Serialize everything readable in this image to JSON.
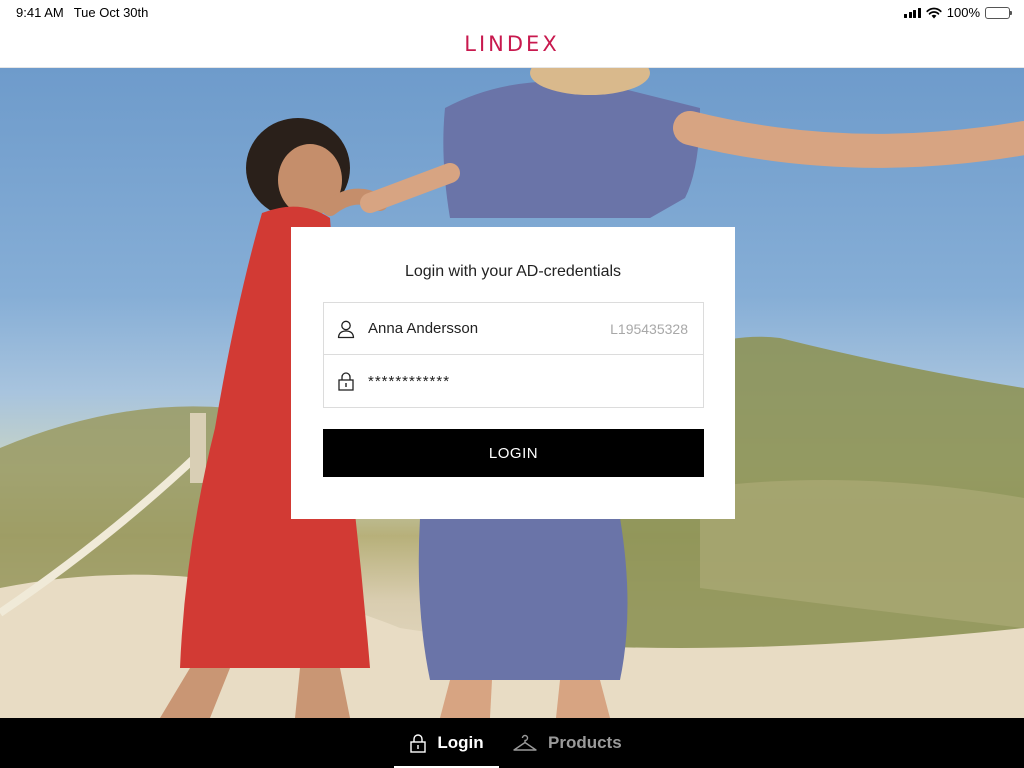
{
  "status_bar": {
    "time": "9:41 AM",
    "date": "Tue Oct 30th",
    "battery": "100%"
  },
  "header": {
    "logo": "LINDEX",
    "logo_color": "#c8194e"
  },
  "login_card": {
    "title": "Login with your AD-credentials",
    "username": "Anna Andersson",
    "user_id": "L195435328",
    "password_masked": "************",
    "login_label": "LOGIN"
  },
  "tabbar": {
    "tabs": [
      {
        "label": "Login",
        "icon": "lock-icon",
        "active": true
      },
      {
        "label": "Products",
        "icon": "hanger-icon",
        "active": false
      }
    ]
  }
}
